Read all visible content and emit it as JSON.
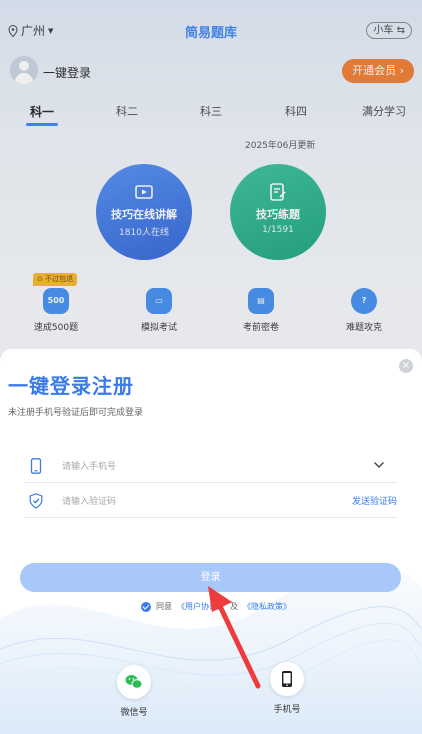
{
  "app": {
    "location": "广州",
    "title": "简易题库",
    "car_type": "小车",
    "user_login": "一键登录",
    "vip_button": "开通会员",
    "tabs": [
      "科一",
      "科二",
      "科三",
      "科四",
      "满分学习"
    ],
    "active_tab": 0,
    "update_note": "2025年06月更新",
    "main_cards": [
      {
        "title": "技巧在线讲解",
        "sub": "1810人在线",
        "color": "#3a74e6"
      },
      {
        "title": "技巧练题",
        "sub": "1/1591",
        "color": "#22b08b"
      }
    ],
    "tools": [
      {
        "label": "速成500题",
        "icon_text": "500"
      },
      {
        "label": "模拟考试",
        "icon_text": ""
      },
      {
        "label": "考前密卷",
        "icon_text": ""
      },
      {
        "label": "难题攻克",
        "icon_text": "?"
      }
    ],
    "nofail_badge": "不过包退"
  },
  "sheet": {
    "title": "一键登录注册",
    "subtitle": "未注册手机号验证后即可完成登录",
    "phone_placeholder": "请输入手机号",
    "code_placeholder": "请输入验证码",
    "send_code": "发送验证码",
    "login_button": "登录",
    "agree_prefix": "同意",
    "user_agreement": "《用户协议》",
    "and": "及",
    "privacy_policy": "《隐私政策》",
    "alt_logins": [
      {
        "label": "微信号",
        "icon": "wechat-icon"
      },
      {
        "label": "手机号",
        "icon": "phone-icon"
      }
    ]
  },
  "colors": {
    "accent": "#3b7be8",
    "vip": "#f07a2e",
    "login_disabled": "#a9c8fa",
    "annotation_arrow": "#ef3b3b"
  }
}
